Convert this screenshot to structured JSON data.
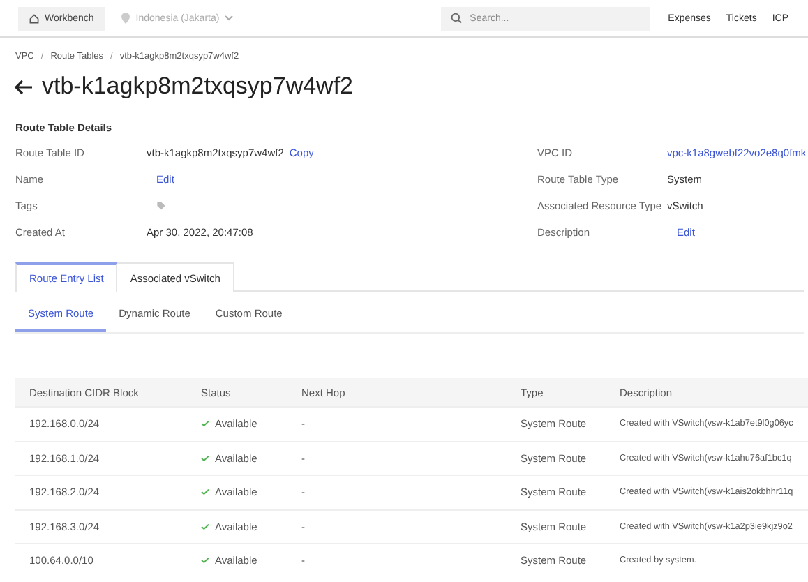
{
  "topbar": {
    "workbench": "Workbench",
    "region": "Indonesia (Jakarta)",
    "search": {
      "placeholder": "Search..."
    },
    "links": [
      "Expenses",
      "Tickets",
      "ICP"
    ]
  },
  "breadcrumb": {
    "separator": "/",
    "items": [
      "VPC",
      "Route Tables",
      "vtb-k1agkp8m2txqsyp7w4wf2"
    ]
  },
  "title": "vtb-k1agkp8m2txqsyp7w4wf2",
  "details": {
    "heading": "Route Table Details",
    "left": [
      {
        "label": "Route Table ID",
        "kind": "copy",
        "value": "vtb-k1agkp8m2txqsyp7w4wf2",
        "action": "Copy"
      },
      {
        "label": "Name",
        "kind": "edit",
        "action": "Edit"
      },
      {
        "label": "Tags",
        "kind": "tag"
      },
      {
        "label": "Created At",
        "kind": "text",
        "value": "Apr 30, 2022, 20:47:08"
      }
    ],
    "right": [
      {
        "label": "VPC ID",
        "kind": "link",
        "value": "vpc-k1a8gwebf22vo2e8q0fmk"
      },
      {
        "label": "Route Table Type",
        "kind": "text",
        "value": "System"
      },
      {
        "label": "Associated Resource Type",
        "kind": "text",
        "value": "vSwitch"
      },
      {
        "label": "Description",
        "kind": "edit",
        "action": "Edit"
      }
    ]
  },
  "tabs": [
    {
      "label": "Route Entry List",
      "selected": true
    },
    {
      "label": "Associated vSwitch",
      "selected": false
    }
  ],
  "subtabs": [
    {
      "label": "System Route",
      "selected": true
    },
    {
      "label": "Dynamic Route",
      "selected": false
    },
    {
      "label": "Custom Route",
      "selected": false
    }
  ],
  "table": {
    "columns": [
      "Destination CIDR Block",
      "Status",
      "Next Hop",
      "Type",
      "Description"
    ],
    "rows": [
      {
        "cidr": "192.168.0.0/24",
        "status": "Available",
        "next_hop": "-",
        "type": "System Route",
        "description": "Created with VSwitch(vsw-k1ab7et9l0g06yc"
      },
      {
        "cidr": "192.168.1.0/24",
        "status": "Available",
        "next_hop": "-",
        "type": "System Route",
        "description": "Created with VSwitch(vsw-k1ahu76af1bc1q"
      },
      {
        "cidr": "192.168.2.0/24",
        "status": "Available",
        "next_hop": "-",
        "type": "System Route",
        "description": "Created with VSwitch(vsw-k1ais2okbhhr11q"
      },
      {
        "cidr": "192.168.3.0/24",
        "status": "Available",
        "next_hop": "-",
        "type": "System Route",
        "description": "Created with VSwitch(vsw-k1a2p3ie9kjz9o2"
      },
      {
        "cidr": "100.64.0.0/10",
        "status": "Available",
        "next_hop": "-",
        "type": "System Route",
        "description": "Created by system."
      }
    ]
  }
}
